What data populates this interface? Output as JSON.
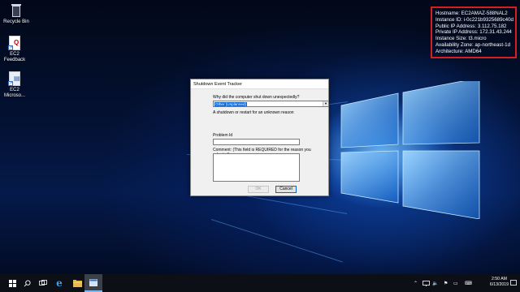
{
  "desktop": {
    "icons": [
      {
        "label": "Recycle Bin"
      },
      {
        "label_line1": "EC2",
        "label_line2": "Feedback"
      },
      {
        "label_line1": "EC2",
        "label_line2": "Microso..."
      }
    ]
  },
  "info_panel": {
    "lines": [
      "Hostname: EC2AMAZ-588NAL2",
      "Instance ID: i-0c221b9325689c40d",
      "Public IP Address: 3.112.75.182",
      "Private IP Address: 172.31.43.244",
      "Instance Size: t3.micro",
      "Availability Zone: ap-northeast-1d",
      "Architecture: AMD64"
    ],
    "border_color": "#d62020"
  },
  "dialog": {
    "title": "Shutdown Event Tracker",
    "question": "Why did the computer shut down unexpectedly?",
    "reason_selected": "Other (Unplanned)",
    "reason_description": "A shutdown or restart for an unknown reason",
    "problem_id_label": "Problem Id",
    "problem_id_value": "",
    "comment_label": "Comment: (This field is REQUIRED for the reason you selected)",
    "comment_value": "",
    "ok_label": "OK",
    "cancel_label": "Cancel"
  },
  "taskbar": {
    "clock_time": "2:50 AM",
    "clock_date": "6/13/2019",
    "accent": "#76b9ed"
  }
}
